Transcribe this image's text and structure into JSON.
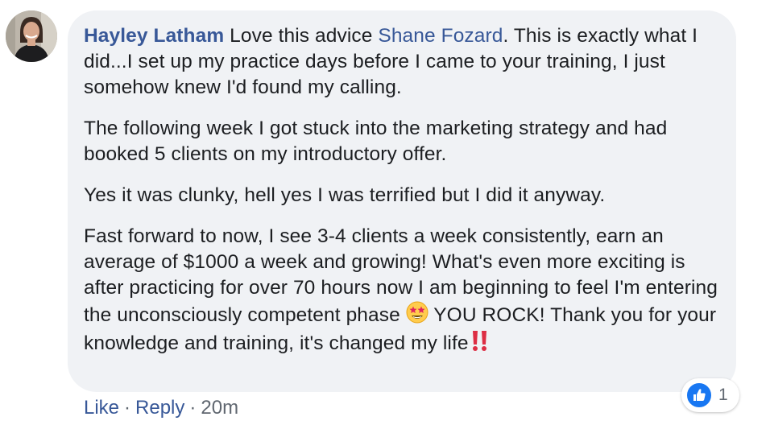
{
  "comment": {
    "author": "Hayley Latham",
    "intro": "Love this advice",
    "mention": "Shane Fozard",
    "intro_rest": ". This is exactly what I did...I set up my practice days before I came to your training, I just somehow knew I'd found my calling.",
    "paragraph2": "The following week I got stuck into the marketing strategy and had booked 5 clients on my introductory offer.",
    "paragraph3": "Yes it was clunky, hell yes I was terrified but I did it anyway.",
    "paragraph4_part1": "Fast forward to now, I see 3-4 clients a week consistently, earn an average of $1000 a week and growing! What's even more exciting is after practicing for over 70 hours now I am beginning to feel I'm entering the unconsciously competent phase",
    "paragraph4_part2": "YOU ROCK! Thank you for your knowledge and training, it's changed my life",
    "emoji_1": "star-struck",
    "emoji_2": "double-exclamation"
  },
  "actions": {
    "like_label": "Like",
    "separator": "·",
    "reply_label": "Reply",
    "timestamp": "20m"
  },
  "reactions": {
    "icon": "like-thumb-icon",
    "count": "1"
  },
  "colors": {
    "link": "#385898",
    "bubble": "#f0f2f5",
    "text": "#1c1e21",
    "muted": "#606770",
    "like_blue": "#1877f2"
  }
}
